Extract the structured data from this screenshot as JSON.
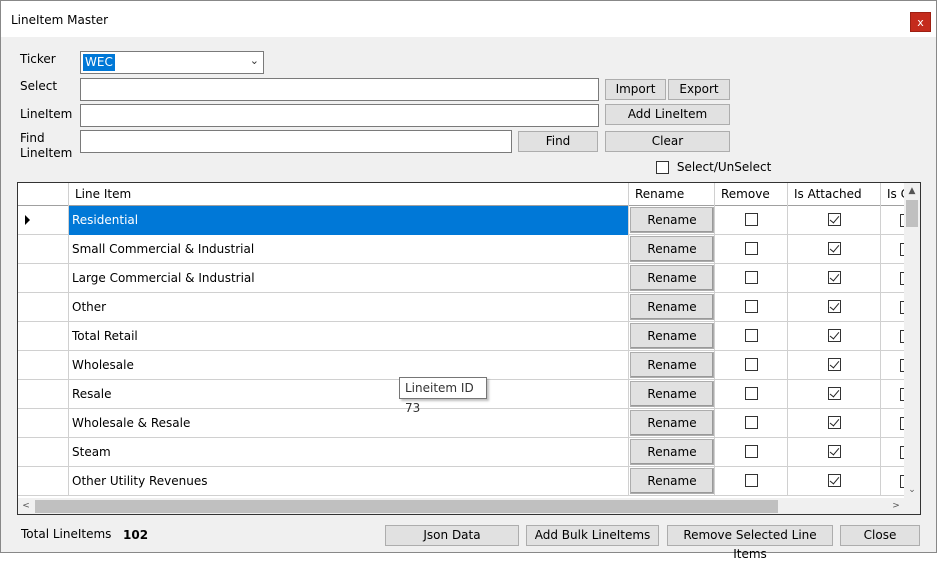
{
  "window": {
    "title": "LineItem Master",
    "close_label": "x"
  },
  "form": {
    "ticker_label": "Ticker",
    "ticker_value": "WEC",
    "select_label": "Select",
    "lineitem_label": "LineItem",
    "find_label_1": "Find",
    "find_label_2": "LineItem",
    "select_value": "",
    "lineitem_value": "",
    "find_value": ""
  },
  "buttons": {
    "import": "Import",
    "export": "Export",
    "add_lineitem": "Add LineItem",
    "find": "Find",
    "clear": "Clear",
    "select_unselect": "Select/UnSelect",
    "json_data": "Json Data",
    "add_bulk": "Add Bulk LineItems",
    "remove_selected": "Remove Selected Line Items",
    "close": "Close"
  },
  "grid": {
    "columns": [
      "Line Item",
      "Rename",
      "Remove",
      "Is Attached",
      "Is C"
    ],
    "rename_label": "Rename",
    "rows": [
      {
        "name": "Residential",
        "remove": false,
        "attached": true,
        "selected": true
      },
      {
        "name": "Small Commercial & Industrial",
        "remove": false,
        "attached": true
      },
      {
        "name": "Large Commercial & Industrial",
        "remove": false,
        "attached": true
      },
      {
        "name": "Other",
        "remove": false,
        "attached": true
      },
      {
        "name": "Total Retail",
        "remove": false,
        "attached": true
      },
      {
        "name": "Wholesale",
        "remove": false,
        "attached": true
      },
      {
        "name": "Resale",
        "remove": false,
        "attached": true
      },
      {
        "name": "Wholesale & Resale",
        "remove": false,
        "attached": true
      },
      {
        "name": "Steam",
        "remove": false,
        "attached": true
      },
      {
        "name": "Other Utility Revenues",
        "remove": false,
        "attached": true
      }
    ]
  },
  "tooltip": {
    "text": "Lineitem ID 73"
  },
  "footer": {
    "total_label": "Total LineItems",
    "total_value": "102"
  },
  "colors": {
    "selection": "#0078d7",
    "close_red": "#c42b1c"
  }
}
